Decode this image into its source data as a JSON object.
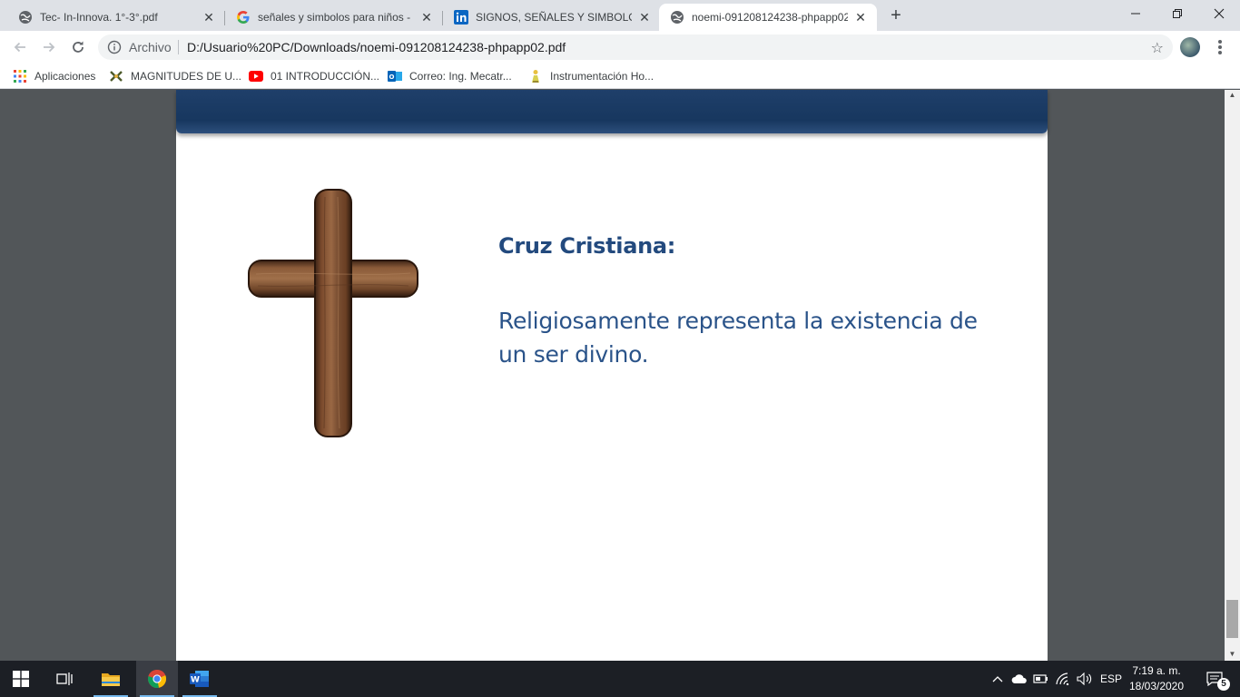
{
  "browser": {
    "tabs": [
      {
        "title": "Tec- In-Innova. 1°-3°.pdf",
        "icon": "globe-icon",
        "active": false
      },
      {
        "title": "señales y simbolos para niños - B",
        "icon": "google-icon",
        "active": false
      },
      {
        "title": "SIGNOS, SEÑALES Y SIMBOLOS",
        "icon": "linkedin-icon",
        "active": false
      },
      {
        "title": "noemi-091208124238-phpapp02",
        "icon": "globe-icon",
        "active": true
      }
    ],
    "new_tab_label": "+",
    "close_glyph": "✕",
    "address": {
      "chip": "Archivo",
      "url": "D:/Usuario%20PC/Downloads/noemi-091208124238-phpapp02.pdf"
    },
    "bookmarks": [
      {
        "label": "Aplicaciones",
        "icon": "apps-grid-icon"
      },
      {
        "label": "MAGNITUDES DE U...",
        "icon": "flag-icon"
      },
      {
        "label": "01 INTRODUCCIÓN...",
        "icon": "youtube-icon"
      },
      {
        "label": "Correo: Ing. Mecatr...",
        "icon": "outlook-icon"
      },
      {
        "label": "Instrumentación Ho...",
        "icon": "figure-icon"
      }
    ]
  },
  "slide": {
    "heading": "Cruz Cristiana:",
    "body": "Religiosamente representa la existencia de un ser divino.",
    "image": "wooden-cross-image",
    "banner_color": "#1f3f6a",
    "text_color": "#2a5389"
  },
  "taskbar": {
    "language": "ESP",
    "time": "7:19 a. m.",
    "date": "18/03/2020",
    "notifications": "5",
    "apps": [
      "windows-start-icon",
      "task-view-icon",
      "file-explorer-icon",
      "chrome-icon",
      "word-icon"
    ]
  },
  "colors": {
    "tabstrip": "#dee1e6",
    "viewer_bg": "#525659",
    "taskbar": "#1c1f25"
  }
}
